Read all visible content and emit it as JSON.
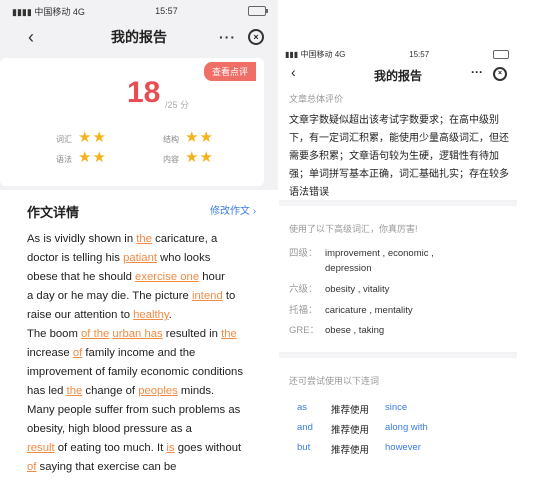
{
  "left_phone": {
    "status": {
      "carrier": "中国移动",
      "network": "4G",
      "time": "15:57"
    },
    "nav": {
      "title": "我的报告",
      "back": "‹",
      "more": "···",
      "close": "⊗"
    },
    "score": {
      "tag": "查看点评",
      "value": "18",
      "total": "/25 分"
    },
    "criteria": [
      {
        "label": "词汇",
        "stars": "★★"
      },
      {
        "label": "结构",
        "stars": "★★"
      },
      {
        "label": "语法",
        "stars": "★★"
      },
      {
        "label": "内容",
        "stars": "★★"
      }
    ],
    "detail": {
      "title": "作文详情",
      "edit_label": "修改作文 ›"
    },
    "essay_lines": [
      [
        "As is vividly shown in ",
        {
          "e": "the"
        },
        " caricature, a"
      ],
      [
        "doctor is telling his ",
        {
          "e": "patiant"
        },
        " who looks"
      ],
      [
        "obese that he should ",
        {
          "e": "exercise one"
        },
        " hour"
      ],
      [
        "a day or he may die. The picture ",
        {
          "e": "intend"
        },
        " to"
      ],
      [
        "raise our attention to ",
        {
          "e": "healthy"
        },
        "."
      ],
      [
        "The boom ",
        {
          "e": "of the"
        },
        " ",
        {
          "e": "urban has"
        },
        " resulted in ",
        {
          "e": "the"
        }
      ],
      [
        "increase ",
        {
          "e": "of"
        },
        " family income and the"
      ],
      [
        "improvement of family economic conditions"
      ],
      [
        "has led ",
        {
          "e": "the"
        },
        " change of ",
        {
          "e": "peoples"
        },
        " minds."
      ],
      [
        "Many people suffer from such problems as"
      ],
      [
        "obesity, high blood pressure as a"
      ],
      [
        {
          "e": "result"
        },
        " of eating too much. It ",
        {
          "e": "is"
        },
        " goes without"
      ],
      [
        {
          "e": "of"
        },
        " saying that exercise can be"
      ]
    ]
  },
  "right_phone": {
    "status": {
      "carrier": "中国移动",
      "network": "4G",
      "time": "15:57"
    },
    "nav": {
      "title": "我的报告",
      "back": "‹",
      "more": "···",
      "close": "⊗"
    },
    "overall_label": "文章总体评价",
    "overall_text": "文章字数疑似超出该考试字数要求；在高中级别下，有一定词汇积累，能使用少量高级词汇，但还需要多积累；文章语句较为生硬，逻辑性有待加强；单词拼写基本正确，词汇基础扎实；存在较多语法错误",
    "vocab_label": "使用了以下高级词汇，你真厉害!",
    "vocab": [
      {
        "level": "四级：",
        "words": "improvement , economic ,",
        "words2": "depression"
      },
      {
        "level": "六级：",
        "words": "obesity , vitality"
      },
      {
        "level": "托福：",
        "words": "caricature , mentality"
      },
      {
        "level": "GRE：",
        "words": "obese , taking"
      }
    ],
    "conn_label": "还可尝试使用以下连词",
    "connectives": [
      {
        "from": "as",
        "rec": "推荐使用",
        "to": "since"
      },
      {
        "from": "and",
        "rec": "推荐使用",
        "to": "along with"
      },
      {
        "from": "but",
        "rec": "推荐使用",
        "to": "however"
      }
    ]
  }
}
